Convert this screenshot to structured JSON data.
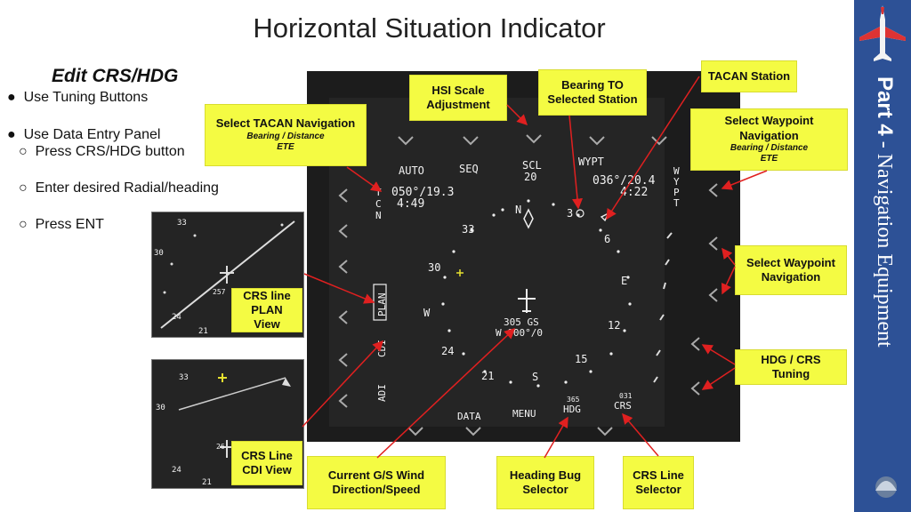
{
  "title": "Horizontal Situation Indicator",
  "subtitle": "Edit CRS/HDG",
  "bullets": [
    {
      "text": "Use Tuning Buttons",
      "marker": "●"
    },
    {
      "text": "Use Data Entry Panel",
      "marker": "●"
    },
    {
      "text": "Press CRS/HDG button",
      "marker": "○"
    },
    {
      "text": "Enter desired Radial/heading",
      "marker": "○"
    },
    {
      "text": "Press ENT",
      "marker": "○"
    }
  ],
  "sidebar": {
    "part": "Part 4",
    "dash": " - ",
    "section": "Navigation Equipment",
    "color": "#2d5196"
  },
  "callouts": {
    "hsi_scale": "HSI Scale Adjustment",
    "bearing_to": "Bearing TO Selected Station",
    "tacan_station": "TACAN Station",
    "select_tacan": {
      "title": "Select TACAN Navigation",
      "note1": "Bearing / Distance",
      "note2": "ETE"
    },
    "select_waypoint": {
      "title": "Select Waypoint Navigation",
      "note1": "Bearing / Distance",
      "note2": "ETE"
    },
    "select_waypoint_nav": "Select Waypoint Navigation",
    "hdg_crs_tuning": "HDG / CRS Tuning",
    "crs_line_plan": "CRS line PLAN View",
    "crs_line_cdi": "CRS Line CDI View",
    "current_gs": "Current G/S Wind Direction/Speed",
    "heading_bug": "Heading Bug Selector",
    "crs_line_selector": "CRS Line Selector"
  },
  "display": {
    "top_labels": [
      "AUTO",
      "SEQ",
      "SCL",
      "20",
      "WYPT"
    ],
    "tacan_readout": "050°/19.3",
    "tacan_time": "4:49",
    "wpt_readout": "036°/20.4",
    "wpt_time": "4:22",
    "side_left": [
      "T",
      "C",
      "N"
    ],
    "mode_labels": [
      "PLAN",
      "CDI",
      "ADI"
    ],
    "right_side": [
      "W",
      "Y",
      "P",
      "T"
    ],
    "bottom_labels": [
      "DATA",
      "MENU",
      "HDG",
      "CRS"
    ],
    "hdg_value": "365",
    "crs_value": "031",
    "gs_label": "305 GS",
    "wind": "W 000°/0",
    "compass": [
      "N",
      "3",
      "6",
      "E",
      "12",
      "15",
      "S",
      "21",
      "24",
      "W",
      "30",
      "33"
    ]
  },
  "thumbs": {
    "plan": [
      "33",
      "30",
      "257",
      "24",
      "21"
    ],
    "cdi": [
      "33",
      "30",
      "26",
      "24",
      "21"
    ]
  },
  "colors": {
    "callout": "#f4fb43",
    "arrow": "#e02020",
    "screen": "#252525"
  }
}
